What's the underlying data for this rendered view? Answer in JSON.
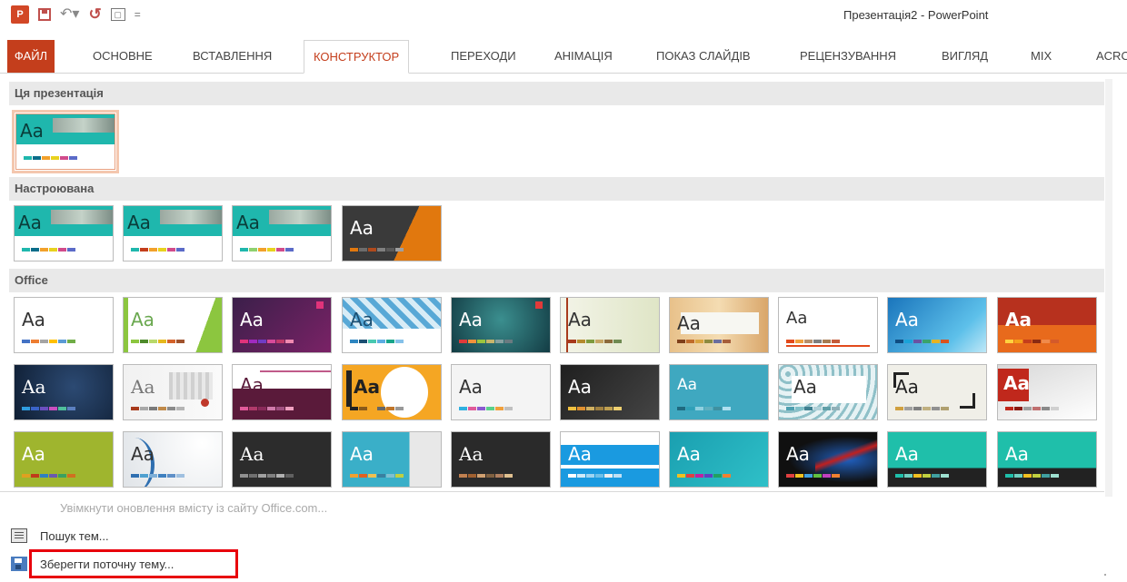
{
  "window": {
    "title": "Презентація2 - PowerPoint"
  },
  "quick_access": {
    "app_icon_text": "P",
    "icons": [
      "powerpoint-icon",
      "save-icon",
      "undo-icon",
      "redo-icon",
      "start-from-beginning-icon",
      "customize-qat-icon"
    ]
  },
  "tabs": [
    {
      "label": "ФАЙЛ"
    },
    {
      "label": "ОСНОВНЕ"
    },
    {
      "label": "ВСТАВЛЕННЯ"
    },
    {
      "label": "КОНСТРУКТОР"
    },
    {
      "label": "ПЕРЕХОДИ"
    },
    {
      "label": "АНІМАЦІЯ"
    },
    {
      "label": "ПОКАЗ СЛАЙДІВ"
    },
    {
      "label": "РЕЦЕНЗУВАННЯ"
    },
    {
      "label": "ВИГЛЯД"
    },
    {
      "label": "MIX"
    },
    {
      "label": "ACRO"
    }
  ],
  "active_tab": "КОНСТРУКТОР",
  "gallery": {
    "sections": [
      {
        "title": "Ця презентація"
      },
      {
        "title": "Настроювана"
      },
      {
        "title": "Office"
      }
    ],
    "thumb_text": "Aa"
  },
  "commands": {
    "enable_updates": "Увімкнути оновлення вмісту із сайту Office.com...",
    "browse_themes": "Пошук тем...",
    "save_theme": "Зберегти поточну тему..."
  },
  "colors": {
    "accent": "#c43e1c",
    "highlight": "#e8000b"
  }
}
